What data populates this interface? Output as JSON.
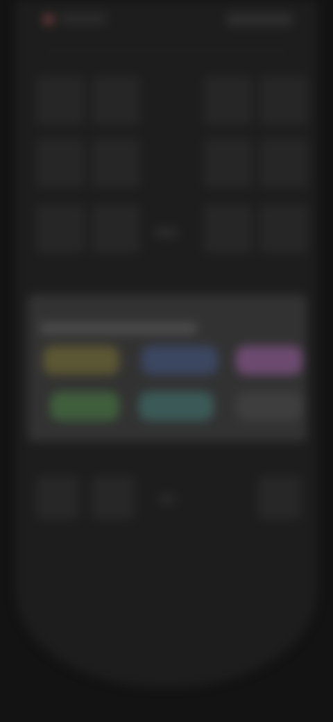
{
  "screen": {
    "state": "blurred",
    "theme_bg": "#131313",
    "device_color": "#1d1d1d"
  },
  "status_bar": {
    "power_icon": "power-icon",
    "power_color": "#6a3a3a"
  },
  "keypad": {
    "rows": 3,
    "left_cols": 2,
    "right_cols": 2
  },
  "color_panel": {
    "chips": [
      {
        "name": "yellow",
        "color": "#5b5633"
      },
      {
        "name": "blue",
        "color": "#3b4660"
      },
      {
        "name": "purple",
        "color": "#6c4a70"
      },
      {
        "name": "green",
        "color": "#3f5e3c"
      },
      {
        "name": "teal",
        "color": "#3b5a57"
      },
      {
        "name": "gray",
        "color": "#3e3e3e"
      }
    ]
  },
  "bottom_row": {
    "buttons": 3
  }
}
